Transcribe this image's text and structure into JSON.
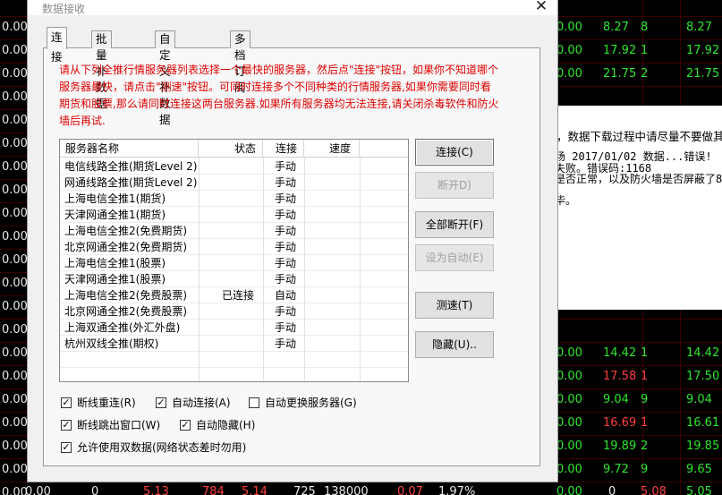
{
  "dialog": {
    "title": "数据接收",
    "close_glyph": "✕",
    "tabs": [
      "连接",
      "批量补数据",
      "自定义补数据",
      "多档订阅"
    ],
    "notice": "请从下列全推行情服务器列表选择一个最快的服务器，然后点\"连接\"按钮，如果你不知道哪个服务器最快，请点击\"测速\"按钮。可同时连接多个不同种类的行情服务器,如果你需要同时看期货和股票,那么请同时连接这两台服务器.如果所有服务器均无法连接,请关闭杀毒软件和防火墙后再试.",
    "columns": [
      "服务器名称",
      "状态",
      "连接",
      "速度"
    ],
    "servers": [
      {
        "name": "电信线路全推(期货Level 2)",
        "status": "",
        "connect": "手动",
        "speed": ""
      },
      {
        "name": "网通线路全推(期货Level 2)",
        "status": "",
        "connect": "手动",
        "speed": ""
      },
      {
        "name": "上海电信全推1(期货)",
        "status": "",
        "connect": "手动",
        "speed": ""
      },
      {
        "name": "天津网通全推1(期货)",
        "status": "",
        "connect": "手动",
        "speed": ""
      },
      {
        "name": "上海电信全推2(免费期货)",
        "status": "",
        "connect": "手动",
        "speed": ""
      },
      {
        "name": "北京网通全推2(免费期货)",
        "status": "",
        "connect": "手动",
        "speed": ""
      },
      {
        "name": "上海电信全推1(股票)",
        "status": "",
        "connect": "手动",
        "speed": ""
      },
      {
        "name": "天津网通全推1(股票)",
        "status": "",
        "connect": "手动",
        "speed": ""
      },
      {
        "name": "上海电信全推2(免费股票)",
        "status": "已连接",
        "connect": "自动",
        "speed": ""
      },
      {
        "name": "北京网通全推2(免费股票)",
        "status": "",
        "connect": "手动",
        "speed": ""
      },
      {
        "name": "上海双通全推(外汇外盘)",
        "status": "",
        "connect": "手动",
        "speed": ""
      },
      {
        "name": "杭州双线全推(期权)",
        "status": "",
        "connect": "手动",
        "speed": ""
      }
    ],
    "buttons": {
      "connect": "连接(C)",
      "disconnect": "断开D)",
      "disconnect_all": "全部断开(F)",
      "set_auto": "设为自动(E)",
      "speed_test": "测速(T)",
      "hide": "隐藏(U).."
    },
    "options": {
      "reconnect": {
        "label": "断线重连(R)",
        "checked": true
      },
      "auto_connect": {
        "label": "自动连接(A)",
        "checked": true
      },
      "auto_switch": {
        "label": "自动更换服务器(G)",
        "checked": false
      },
      "popup_on_disconnect": {
        "label": "断线跳出窗口(W)",
        "checked": true
      },
      "auto_hide": {
        "label": "自动隐藏(H)",
        "checked": true
      },
      "dual_data": {
        "label": "允许使用双数据(网络状态差时勿用)",
        "checked": true
      }
    },
    "check_glyph": "✓"
  },
  "log": {
    "lines": [
      "，数据下载过程中请尽量不要做其他",
      "场 2017/01/02 数据...错误!",
      "失败。错误码:1168",
      "是否正常，以及防火墙是否屏蔽了8",
      "。",
      "毕。"
    ]
  },
  "quotes": {
    "top_rows": [
      {
        "c1": "0.00",
        "c2": "8.27",
        "c3": "8",
        "c4": "8.27"
      },
      {
        "c1": "0.00",
        "c2": "17.92",
        "c3": "1",
        "c4": "17.92"
      },
      {
        "c1": "0.00",
        "c2": "21.75",
        "c3": "2",
        "c4": "21.75"
      }
    ],
    "bottom_rows": [
      {
        "c1": "0.00",
        "c2": "14.42",
        "c3": "1",
        "c4": "14.42"
      },
      {
        "c1": "0.00",
        "c2": "17.58",
        "c3": "1",
        "c4": "17.50"
      },
      {
        "c1": "0.00",
        "c2": "9.04",
        "c3": "9",
        "c4": "9.04"
      },
      {
        "c1": "0.00",
        "c2": "16.69",
        "c3": "1",
        "c4": "16.61"
      },
      {
        "c1": "0.00",
        "c2": "19.89",
        "c3": "2",
        "c4": "19.85"
      },
      {
        "c1": "0.00",
        "c2": "9.72",
        "c3": "9",
        "c4": "9.65"
      }
    ],
    "left_col": [
      "0.00",
      "0.00",
      "0.00",
      "0.00",
      "0.00",
      "0.00",
      "0.00",
      "0.00",
      "0.00",
      "0.00",
      "0.00",
      "0.00",
      "0.00",
      "0.00",
      "0.00",
      "0.00",
      "0.00",
      "0.00",
      "0.00",
      "0.00",
      "0.00"
    ],
    "bottom_line": [
      "0.00",
      "0",
      "5.13",
      "784",
      "5.14",
      "725",
      "138000",
      "0.07",
      "1.97%",
      "0.00",
      "0",
      "5.08",
      "5",
      "5.05"
    ]
  }
}
